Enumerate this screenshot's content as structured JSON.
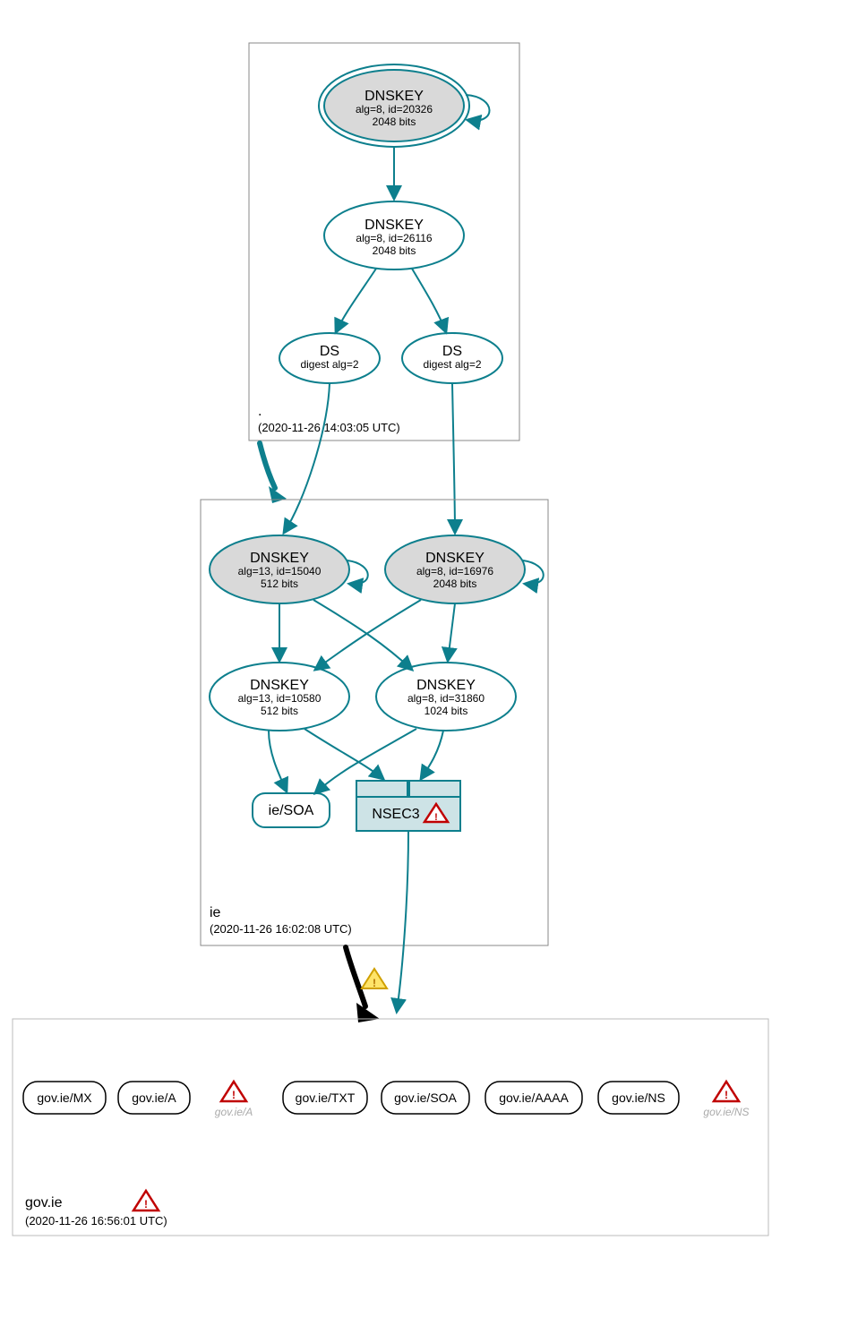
{
  "zones": {
    "root": {
      "label": ".",
      "timestamp": "(2020-11-26 14:03:05 UTC)",
      "nodes": {
        "ksk": {
          "title": "DNSKEY",
          "line2": "alg=8, id=20326",
          "line3": "2048 bits"
        },
        "zsk": {
          "title": "DNSKEY",
          "line2": "alg=8, id=26116",
          "line3": "2048 bits"
        },
        "ds1": {
          "title": "DS",
          "line2": "digest alg=2"
        },
        "ds2": {
          "title": "DS",
          "line2": "digest alg=2"
        }
      }
    },
    "ie": {
      "label": "ie",
      "timestamp": "(2020-11-26 16:02:08 UTC)",
      "nodes": {
        "ksk1": {
          "title": "DNSKEY",
          "line2": "alg=13, id=15040",
          "line3": "512 bits"
        },
        "ksk2": {
          "title": "DNSKEY",
          "line2": "alg=8, id=16976",
          "line3": "2048 bits"
        },
        "zsk1": {
          "title": "DNSKEY",
          "line2": "alg=13, id=10580",
          "line3": "512 bits"
        },
        "zsk2": {
          "title": "DNSKEY",
          "line2": "alg=8, id=31860",
          "line3": "1024 bits"
        },
        "soa": {
          "title": "ie/SOA"
        },
        "nsec": {
          "title": "NSEC3"
        }
      }
    },
    "govie": {
      "label": "gov.ie",
      "timestamp": "(2020-11-26 16:56:01 UTC)",
      "rrsets": [
        {
          "label": "gov.ie/MX"
        },
        {
          "label": "gov.ie/A"
        },
        {
          "label": "gov.ie/A",
          "error": true
        },
        {
          "label": "gov.ie/TXT"
        },
        {
          "label": "gov.ie/SOA"
        },
        {
          "label": "gov.ie/AAAA"
        },
        {
          "label": "gov.ie/NS"
        },
        {
          "label": "gov.ie/NS",
          "error": true
        }
      ]
    }
  }
}
